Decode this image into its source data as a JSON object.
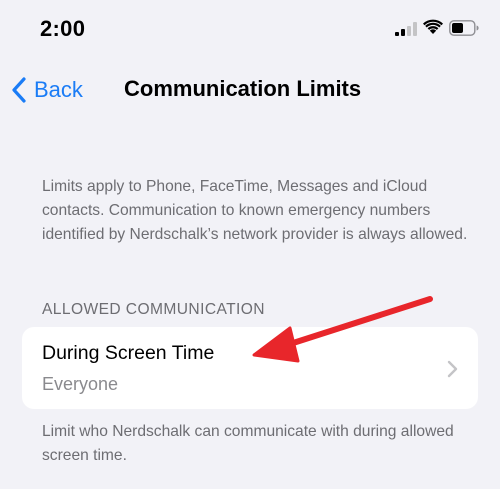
{
  "status_bar": {
    "time": "2:00",
    "signal_icon": "cellular-signal-icon",
    "wifi_icon": "wifi-icon",
    "battery_icon": "battery-icon"
  },
  "nav": {
    "back_label": "Back",
    "title": "Communication Limits"
  },
  "description_top": "Limits apply to Phone, FaceTime, Messages and iCloud contacts. Communication to known emergency numbers identified by Nerdschalk’s network provider is always allowed.",
  "section": {
    "header": "ALLOWED COMMUNICATION",
    "item": {
      "title": "During Screen Time",
      "value": "Everyone"
    },
    "footer": "Limit who Nerdschalk can communicate with during allowed screen time."
  },
  "colors": {
    "accent": "#1a7cf6",
    "background": "#f2f2f7",
    "secondary_text": "#6d6d72",
    "annotation": "#e8262b"
  }
}
